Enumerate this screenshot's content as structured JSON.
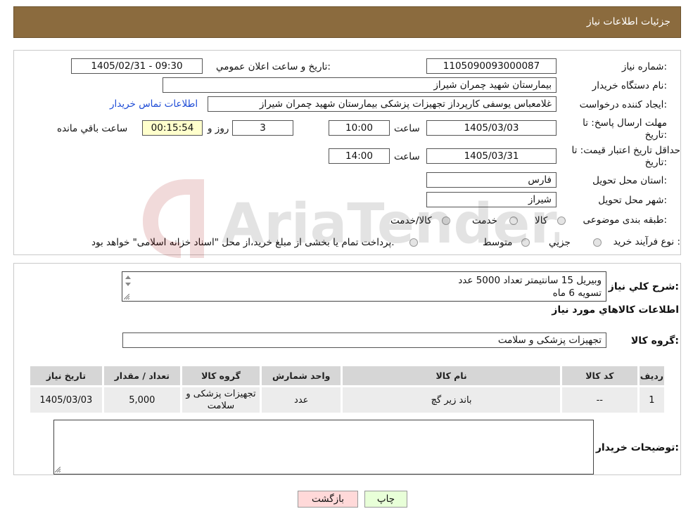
{
  "header": {
    "title": "جزئیات اطلاعات نیاز"
  },
  "fields": {
    "need_number": {
      "label": "شماره نیاز:",
      "value": "1105090093000087"
    },
    "announce": {
      "label": "تاریخ و ساعت اعلان عمومي:",
      "value": "1405/02/31 - 09:30"
    },
    "buyer_org": {
      "label": "نام دستگاه خریدار:",
      "value": "بیمارستان شهید چمران شیراز"
    },
    "requester": {
      "label": "ایجاد کننده درخواست:",
      "value": "غلامعباس  یوسفی کارپرداز تجهیزات پزشکی بیمارستان شهید چمران شیراز",
      "contact_link": "اطلاعات تماس خریدار"
    },
    "deadline": {
      "label_line1": "مهلت ارسال پاسخ: تا",
      "label_line2": "تاریخ:",
      "date": "1405/03/03",
      "time_label": "ساعت",
      "time": "10:00",
      "days": "3",
      "days_label": "روز و",
      "remaining": "00:15:54",
      "remaining_label": "ساعت باقي مانده"
    },
    "validity": {
      "label_line1": "حداقل تاریخ اعتبار قیمت: تا",
      "label_line2": "تاریخ:",
      "date": "1405/03/31",
      "time_label": "ساعت",
      "time": "14:00"
    },
    "province": {
      "label": "استان محل تحویل:",
      "value": "فارس"
    },
    "city": {
      "label": "شهر محل تحویل:",
      "value": "شیراز"
    },
    "category": {
      "label": "طبقه بندی موضوعی:",
      "options": [
        "کالا",
        "خدمت",
        "کالا/خدمت"
      ]
    },
    "process": {
      "label": "نوع فرآیند خرید :",
      "options": [
        "جزيي",
        "متوسط"
      ],
      "note": "پرداخت تمام یا بخشی از مبلغ خرید،از محل \"اسناد خزانه اسلامی\" خواهد بود."
    }
  },
  "description": {
    "label": "شرح كلي نياز:",
    "line1": "وبیریل 15 سانتیمتر تعداد  5000 عدد",
    "line2": "تسویه 6 ماه"
  },
  "goods": {
    "section_title": "اطلاعات كالاهاي مورد نياز",
    "group_label": "گروه كالا:",
    "group_value": "تجهیزات پزشکی و سلامت",
    "columns": [
      "رديف",
      "كد كالا",
      "نام كالا",
      "واحد شمارش",
      "گروه كالا",
      "تعداد / مقدار",
      "تاریخ نیاز"
    ],
    "rows": [
      {
        "row": "1",
        "code": "--",
        "name": "باند زیر گچ",
        "unit": "عدد",
        "group": "تجهیزات پزشکی و سلامت",
        "qty": "5,000",
        "date": "1405/03/03"
      }
    ]
  },
  "buyer_notes": {
    "label": "توضیحات خریدار:",
    "value": ""
  },
  "buttons": {
    "print": "چاپ",
    "back": "بازگشت"
  },
  "watermark": {
    "text": "AriaTender.neT"
  },
  "colors": {
    "header_bg": "#8b6b3e",
    "link": "#1d4bd6",
    "print_btn": "#e8ffd8",
    "back_btn": "#ffd9d9",
    "countdown_bg": "#ffffcc"
  }
}
